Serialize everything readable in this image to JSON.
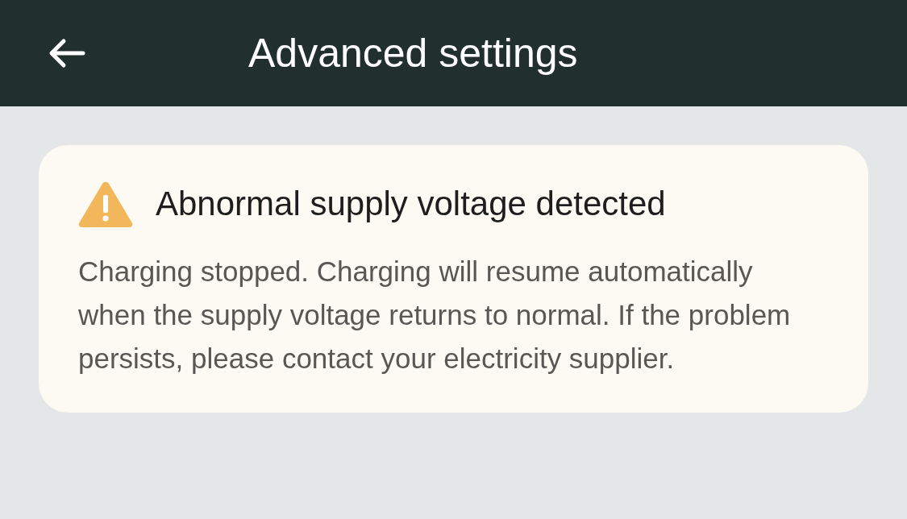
{
  "header": {
    "title": "Advanced settings"
  },
  "alert": {
    "title": "Abnormal supply voltage detected",
    "message": "Charging stopped. Charging will resume automatically when the supply voltage returns to normal. If the problem persists, please contact your electricity supplier."
  }
}
